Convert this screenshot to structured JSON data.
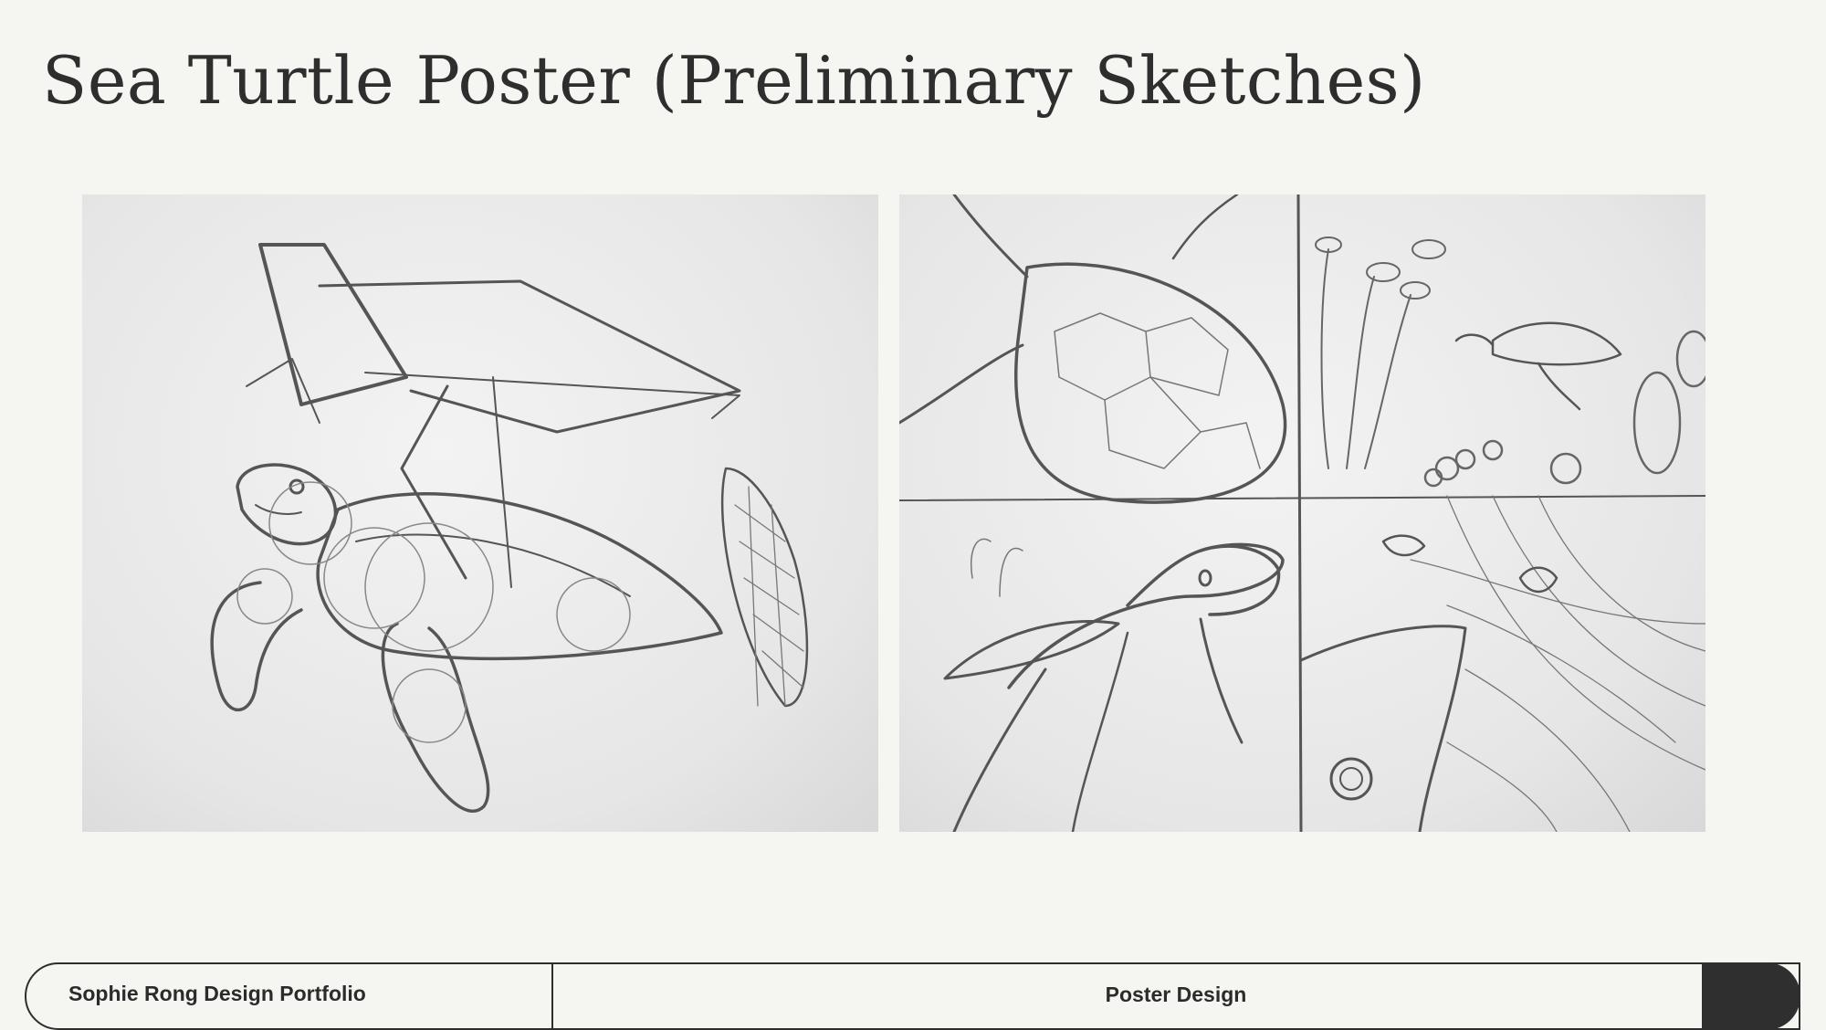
{
  "page": {
    "title": "Sea Turtle Poster (Preliminary Sketches)"
  },
  "images": [
    {
      "name": "sketch-single-turtle",
      "description_icon": "turtle-sketch-icon"
    },
    {
      "name": "sketch-four-panel-storyboard",
      "description_icon": "storyboard-sketch-icon"
    }
  ],
  "footer": {
    "portfolio_label": "Sophie Rong Design Portfolio",
    "section_label": "Poster Design"
  },
  "colors": {
    "background": "#f5f5f1",
    "text": "#2e2e2e",
    "accent_block": "#2f2f2f"
  }
}
